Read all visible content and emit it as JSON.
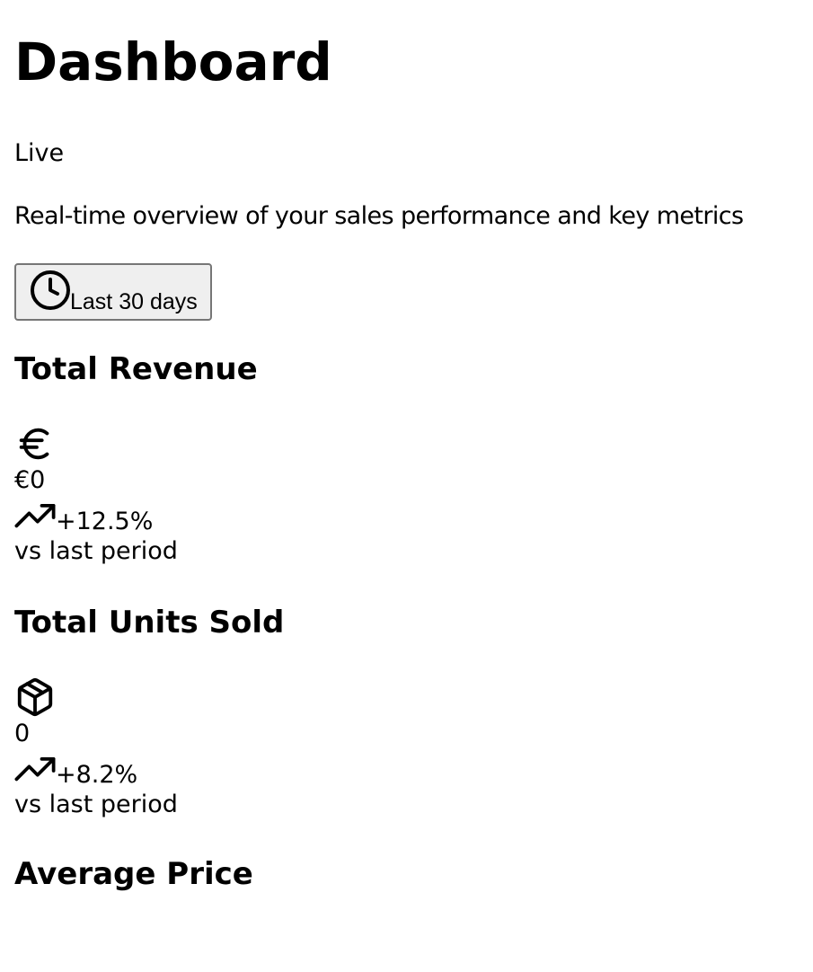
{
  "header": {
    "title": "Dashboard",
    "status": "Live",
    "subtitle": "Real-time overview of your sales performance and key metrics"
  },
  "date_range": {
    "label": "Last 30 days",
    "icon": "clock-icon"
  },
  "metrics": [
    {
      "title": "Total Revenue",
      "icon": "euro-icon",
      "value": "€0",
      "trend": "+12.5%",
      "trend_icon": "trending-up-icon",
      "comparison": "vs last period"
    },
    {
      "title": "Total Units Sold",
      "icon": "package-icon",
      "value": "0",
      "trend": "+8.2%",
      "trend_icon": "trending-up-icon",
      "comparison": "vs last period"
    },
    {
      "title": "Average Price"
    }
  ]
}
